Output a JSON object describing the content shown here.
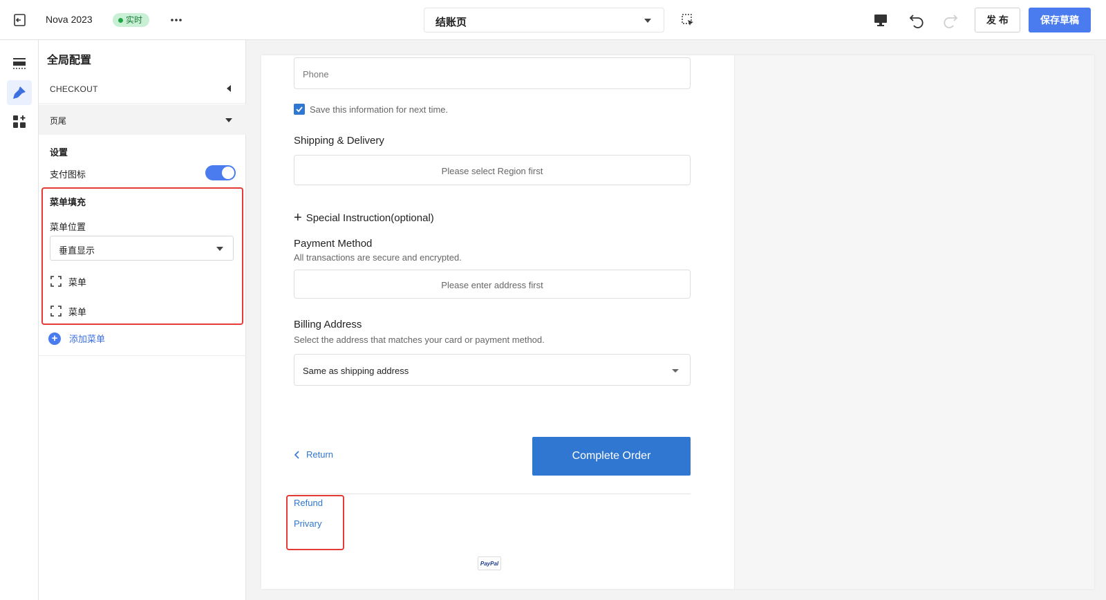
{
  "topbar": {
    "app_title": "Nova 2023",
    "status_badge": "实时",
    "page_selector": "结账页",
    "publish_label": "发 布",
    "save_draft_label": "保存草稿"
  },
  "panel": {
    "title": "全局配置",
    "section": "CHECKOUT",
    "group": "页尾",
    "settings_heading": "设置",
    "payment_icons_label": "支付图标",
    "payment_icons_enabled": true,
    "menu_fill_heading": "菜单填充",
    "menu_position_label": "菜单位置",
    "menu_position_value": "垂直显示",
    "menu_items": [
      "菜单",
      "菜单"
    ],
    "add_menu_label": "添加菜单"
  },
  "checkout": {
    "phone_placeholder": "Phone",
    "save_info_label": "Save this information for next time.",
    "shipping_heading": "Shipping & Delivery",
    "shipping_notice": "Please select Region first",
    "special_instruction": "Special Instruction(optional)",
    "payment_heading": "Payment Method",
    "payment_sub": "All transactions are secure and encrypted.",
    "payment_notice": "Please enter address first",
    "billing_heading": "Billing Address",
    "billing_sub": "Select the address that matches your card or payment method.",
    "billing_select": "Same as shipping address",
    "return_label": "Return",
    "complete_label": "Complete Order",
    "footer_links": [
      "Refund",
      "Privary"
    ],
    "paypal_label": "PayPal"
  },
  "colors": {
    "accent": "#4a7cf0",
    "checkout_blue": "#2f77d0",
    "highlight_red": "#e53935"
  }
}
